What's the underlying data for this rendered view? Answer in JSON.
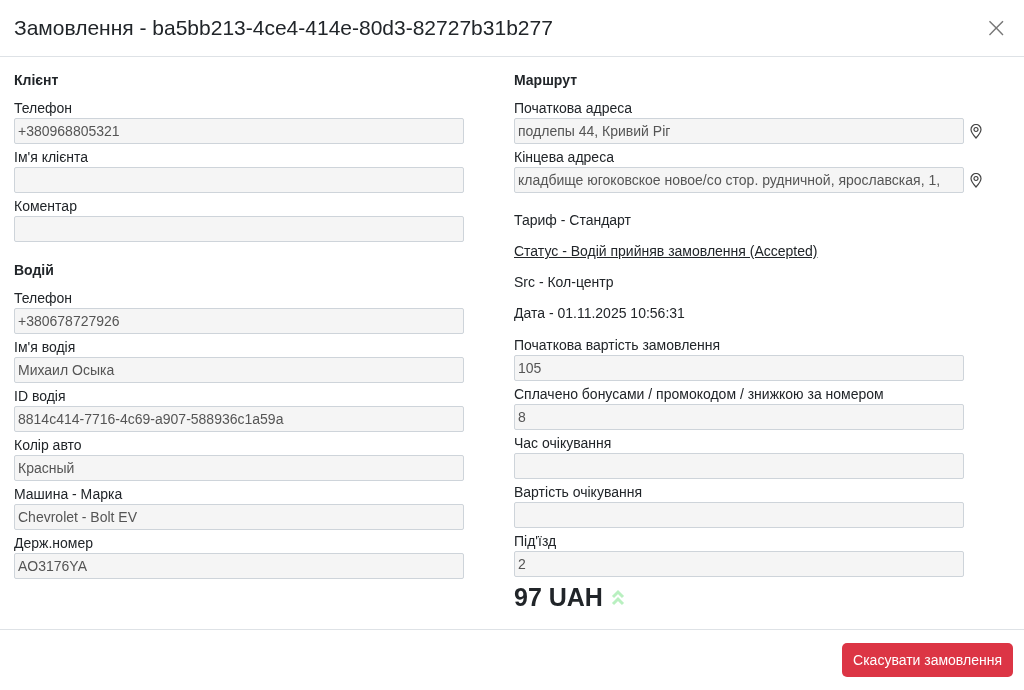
{
  "dialog": {
    "title": "Замовлення - ba5bb213-4ce4-414e-80d3-82727b31b277",
    "close": "×"
  },
  "client": {
    "title": "Клієнт",
    "fields": [
      {
        "label": "Телефон",
        "value": "+380968805321"
      },
      {
        "label": "Ім'я клієнта"
      },
      {
        "label": "Коментар"
      }
    ]
  },
  "driver": {
    "title": "Водій",
    "fields": [
      {
        "label": "Телефон",
        "value": "+380678727926"
      },
      {
        "label": "Ім'я водія",
        "value": "Михаил Осыка"
      },
      {
        "label": "ID водія",
        "value": "8814c414-7716-4c69-a907-588936c1a59a"
      },
      {
        "label": "Колір авто",
        "value": "Красный"
      },
      {
        "label": "Машина - Марка",
        "value": "Chevrolet - Bolt EV"
      },
      {
        "label": "Держ.номер",
        "value": "AO3176YA"
      }
    ]
  },
  "route": {
    "title": "Маршрут",
    "fields": [
      {
        "label": "Початкова адреса",
        "value": "подлепы 44, Кривий Ріг"
      },
      {
        "label": "Кінцева адреса",
        "value": "кладбище югоковское новое/со стор. рудничной, ярославская, 1,"
      }
    ]
  },
  "info": [
    {
      "kind": "text",
      "text": "Тариф - Стандарт"
    },
    {
      "kind": "link",
      "text": "Статус - Водій прийняв замовлення (Accepted)"
    },
    {
      "kind": "text",
      "text": "Src - Кол-центр"
    },
    {
      "kind": "text",
      "text": "Дата - 01.11.2025 10:56:31"
    }
  ],
  "cost_fields": [
    {
      "label": "Початкова вартість замовлення",
      "value": "105"
    },
    {
      "label": "Сплачено бонусами / промокодом / знижкою за номером",
      "value": "8"
    },
    {
      "label": "Час очікування"
    },
    {
      "label": "Вартість очікування"
    },
    {
      "label": "Під'їзд",
      "value": "2"
    }
  ],
  "total": "97 UAH",
  "buttons": [
    "Скасувати замовлення"
  ]
}
